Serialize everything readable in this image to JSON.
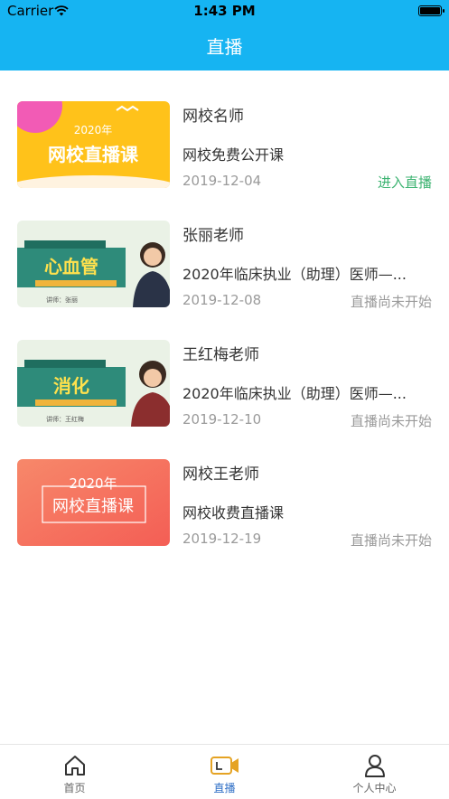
{
  "status_bar": {
    "carrier": "Carrier",
    "time": "1:43 PM"
  },
  "header": {
    "title": "直播"
  },
  "courses": [
    {
      "teacher": "网校名师",
      "course": "网校免费公开课",
      "date": "2019-12-04",
      "status": "进入直播",
      "thumb_title": "2020年",
      "thumb_sub": "网校直播课"
    },
    {
      "teacher": "张丽老师",
      "course": "2020年临床执业（助理）医师—...",
      "date": "2019-12-08",
      "status": "直播尚未开始",
      "thumb_title": "心血管",
      "thumb_sub": "讲师：张丽"
    },
    {
      "teacher": "王红梅老师",
      "course": "2020年临床执业（助理）医师—...",
      "date": "2019-12-10",
      "status": "直播尚未开始",
      "thumb_title": "消化",
      "thumb_sub": "讲师：王红梅"
    },
    {
      "teacher": "网校王老师",
      "course": "网校收费直播课",
      "date": "2019-12-19",
      "status": "直播尚未开始",
      "thumb_title": "2020年",
      "thumb_sub": "网校直播课"
    }
  ],
  "tabs": [
    {
      "label": "首页",
      "icon": "home-icon"
    },
    {
      "label": "直播",
      "icon": "video-camera-icon"
    },
    {
      "label": "个人中心",
      "icon": "user-icon"
    }
  ],
  "colors": {
    "brand": "#16B4F2",
    "live": "#3CB371",
    "tab_active": "#2F6FC6"
  }
}
